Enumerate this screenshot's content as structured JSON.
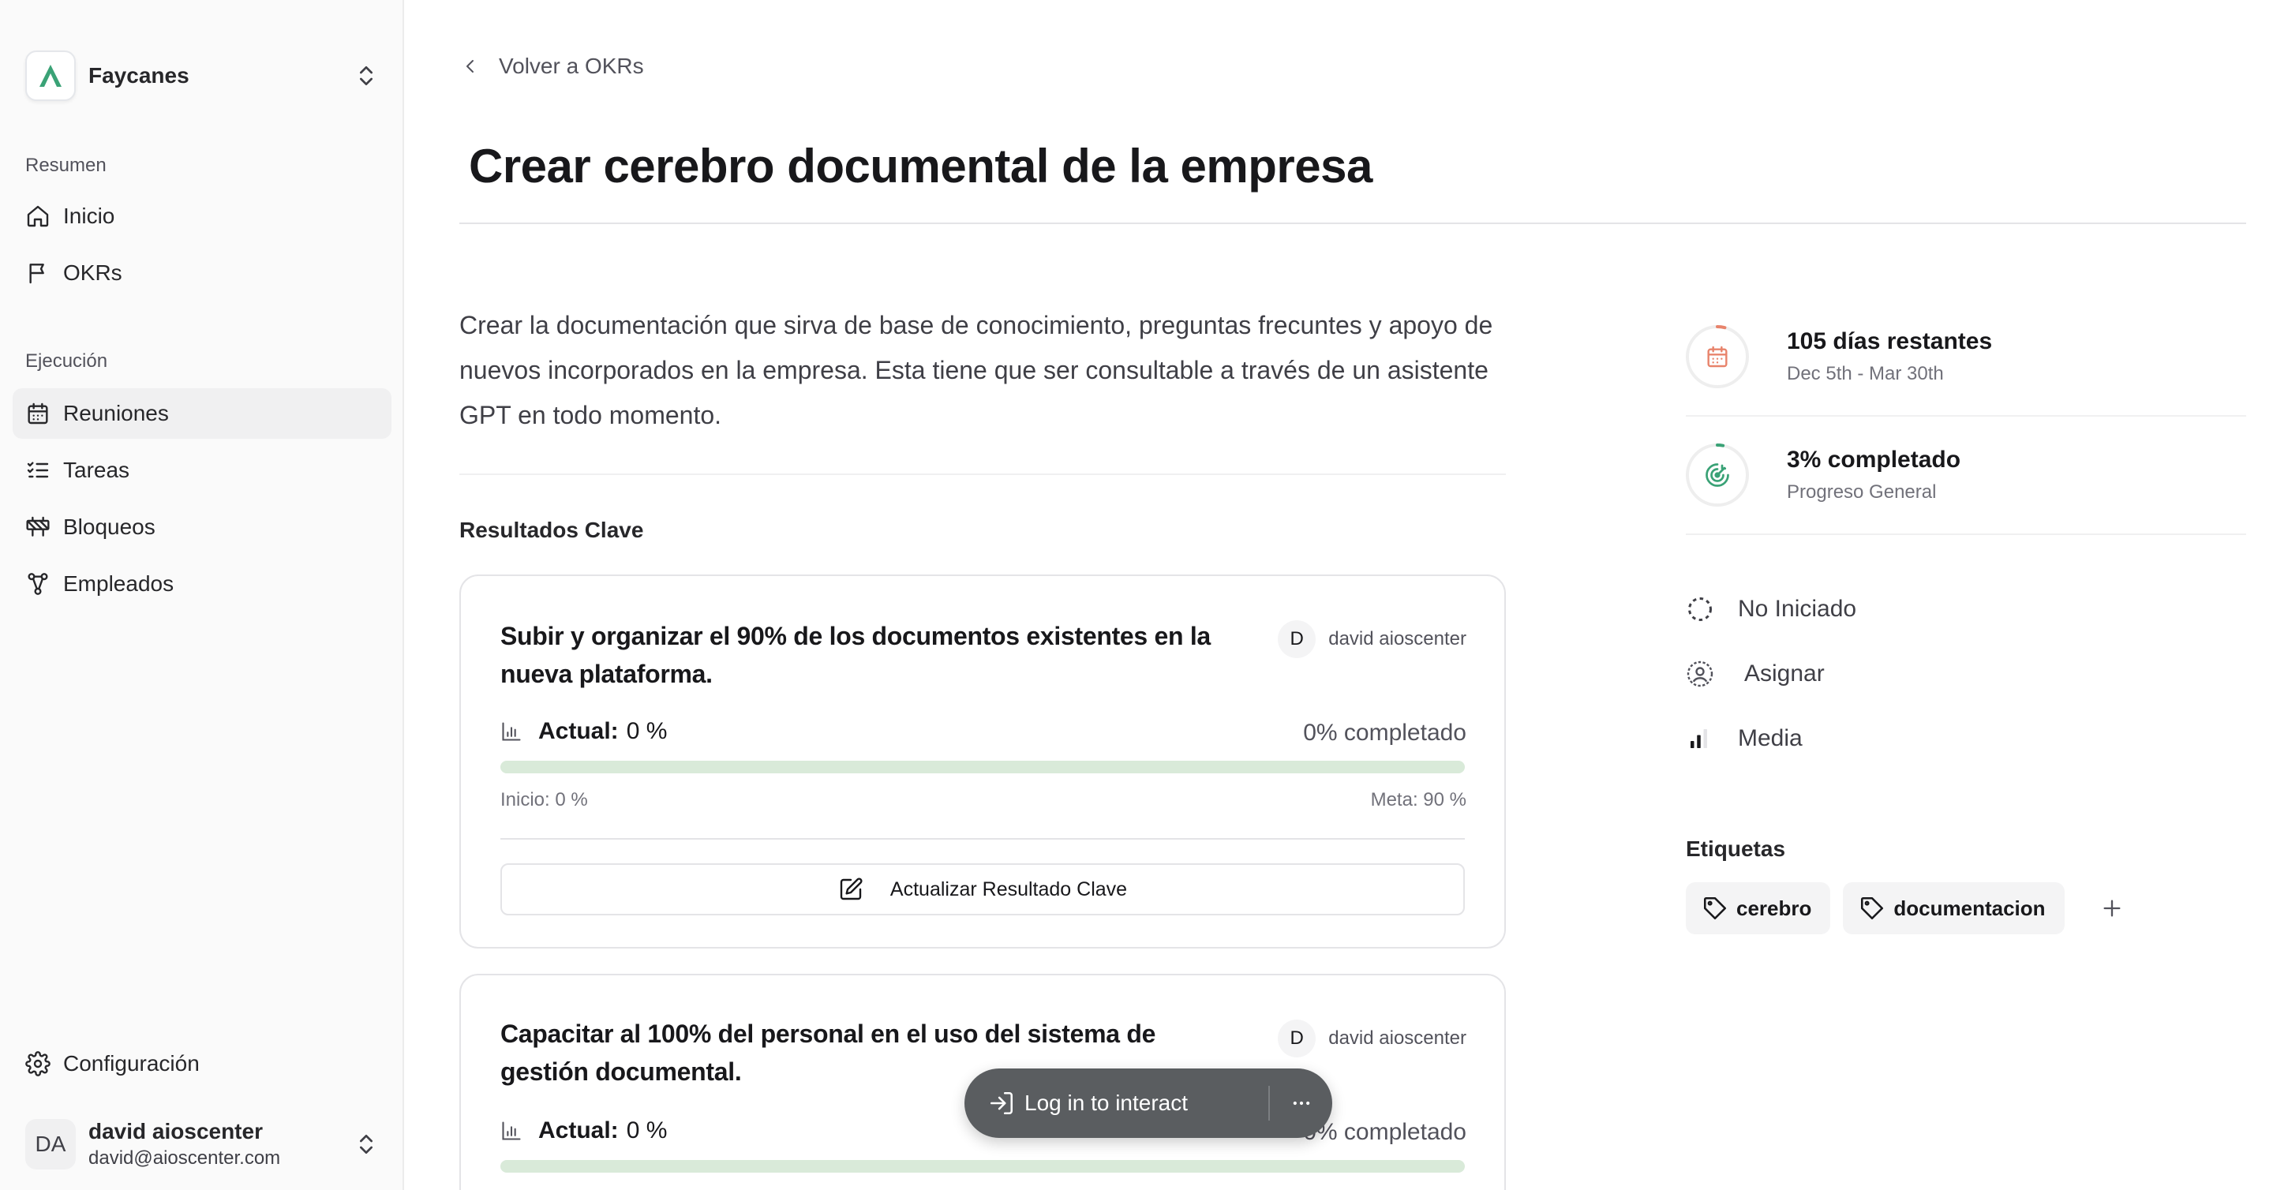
{
  "workspace": {
    "name": "Faycanes"
  },
  "sidebar": {
    "sections": [
      {
        "label": "Resumen",
        "items": [
          {
            "label": "Inicio",
            "icon": "home-icon"
          },
          {
            "label": "OKRs",
            "icon": "flag-icon"
          }
        ]
      },
      {
        "label": "Ejecución",
        "items": [
          {
            "label": "Reuniones",
            "icon": "calendar-icon",
            "active": true
          },
          {
            "label": "Tareas",
            "icon": "list-checks-icon"
          },
          {
            "label": "Bloqueos",
            "icon": "construction-icon"
          },
          {
            "label": "Empleados",
            "icon": "network-icon"
          }
        ]
      }
    ],
    "settings_label": "Configuración",
    "user": {
      "initials": "DA",
      "name": "david aioscenter",
      "email": "david@aioscenter.com"
    }
  },
  "main": {
    "back_label": "Volver a OKRs",
    "title": "Crear cerebro documental de la empresa",
    "description": "Crear la documentación que sirva de base de conocimiento, preguntas frecuntes y apoyo de nuevos incorporados en la empresa. Esta tiene que ser consultable a través de un asistente GPT en todo momento.",
    "key_results_heading": "Resultados Clave",
    "key_results": [
      {
        "title": "Subir y organizar el 90% de los documentos existentes en la nueva plataforma.",
        "owner_initial": "D",
        "owner_name": "david aioscenter",
        "actual_label": "Actual:",
        "actual_value": "0 %",
        "completed_text": "0% completado",
        "progress": 0,
        "start_text": "Inicio: 0 %",
        "goal_text": "Meta: 90 %",
        "update_label": "Actualizar Resultado Clave"
      },
      {
        "title": "Capacitar al 100% del personal en el uso del sistema de gestión documental.",
        "owner_initial": "D",
        "owner_name": "david aioscenter",
        "actual_label": "Actual:",
        "actual_value": "0 %",
        "completed_text": "0% completado",
        "progress": 0
      }
    ]
  },
  "details": {
    "time": {
      "main": "105 días restantes",
      "sub": "Dec 5th - Mar 30th",
      "elapsed": 0.04
    },
    "progress": {
      "main": "3% completado",
      "sub": "Progreso General",
      "value": 0.03
    },
    "status": "No Iniciado",
    "assignee": "Asignar",
    "priority": "Media",
    "tags_heading": "Etiquetas",
    "tags": [
      "cerebro",
      "documentacion"
    ]
  },
  "overlay": {
    "login_label": "Log in to interact"
  },
  "colors": {
    "accent_green": "#3aa276",
    "time_ring": "#e8836b",
    "progress_ring": "#3aa276",
    "bar_track": "#d9ead9"
  }
}
